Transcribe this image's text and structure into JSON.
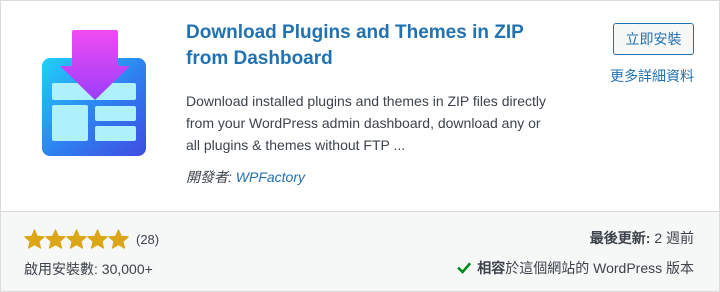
{
  "colors": {
    "accent": "#2271b1",
    "text": "#3c434a",
    "star": "#dba617",
    "check": "#008a20",
    "footer_bg": "#f6f7f7",
    "border": "#dcdcde"
  },
  "icons": {
    "plugin": "download-plugin-icon",
    "star": "star-icon",
    "check": "check-icon"
  },
  "plugin": {
    "title": "Download Plugins and Themes in ZIP from Dashboard",
    "description": "Download installed plugins and themes in ZIP files directly from your WordPress admin dashboard, download any or all plugins & themes without FTP ...",
    "author_label": "開發者:",
    "author_name": "WPFactory"
  },
  "actions": {
    "install_label": "立即安裝",
    "details_label": "更多詳細資料"
  },
  "footer": {
    "rating": {
      "value": 5,
      "max": 5,
      "count_label": "(28)"
    },
    "installs_label": "啟用安裝數:",
    "installs_value": "30,000+",
    "last_updated_label": "最後更新:",
    "last_updated_value": "2 週前",
    "compat_strong": "相容",
    "compat_rest": "於這個網站的 WordPress 版本"
  }
}
